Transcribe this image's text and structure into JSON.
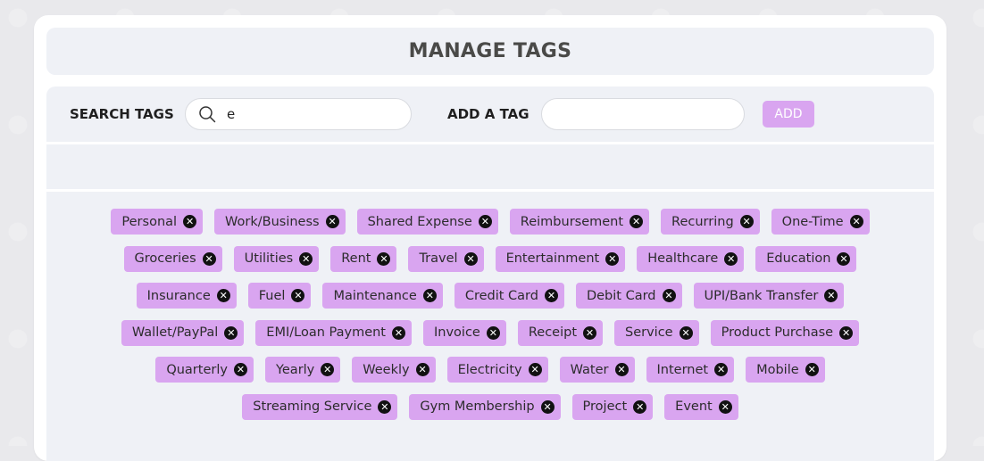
{
  "title": "MANAGE TAGS",
  "search": {
    "label": "SEARCH TAGS",
    "value": "e"
  },
  "add": {
    "label": "ADD A TAG",
    "value": "",
    "button_label": "ADD"
  },
  "colors": {
    "tag_bg": "#d9a5f0",
    "panel_bg": "#eff1f6",
    "title_color": "#4a4a48"
  },
  "tag_rows": [
    [
      "Personal",
      "Work/Business",
      "Shared Expense",
      "Reimbursement",
      "Recurring",
      "One-Time"
    ],
    [
      "Groceries",
      "Utilities",
      "Rent",
      "Travel",
      "Entertainment",
      "Healthcare",
      "Education"
    ],
    [
      "Insurance",
      "Fuel",
      "Maintenance",
      "Credit Card",
      "Debit Card",
      "UPI/Bank Transfer"
    ],
    [
      "Wallet/PayPal",
      "EMI/Loan Payment",
      "Invoice",
      "Receipt",
      "Service",
      "Product Purchase"
    ],
    [
      "Quarterly",
      "Yearly",
      "Weekly",
      "Electricity",
      "Water",
      "Internet",
      "Mobile"
    ],
    [
      "Streaming Service",
      "Gym Membership",
      "Project",
      "Event"
    ]
  ],
  "remove_icon": "close-circle-icon"
}
